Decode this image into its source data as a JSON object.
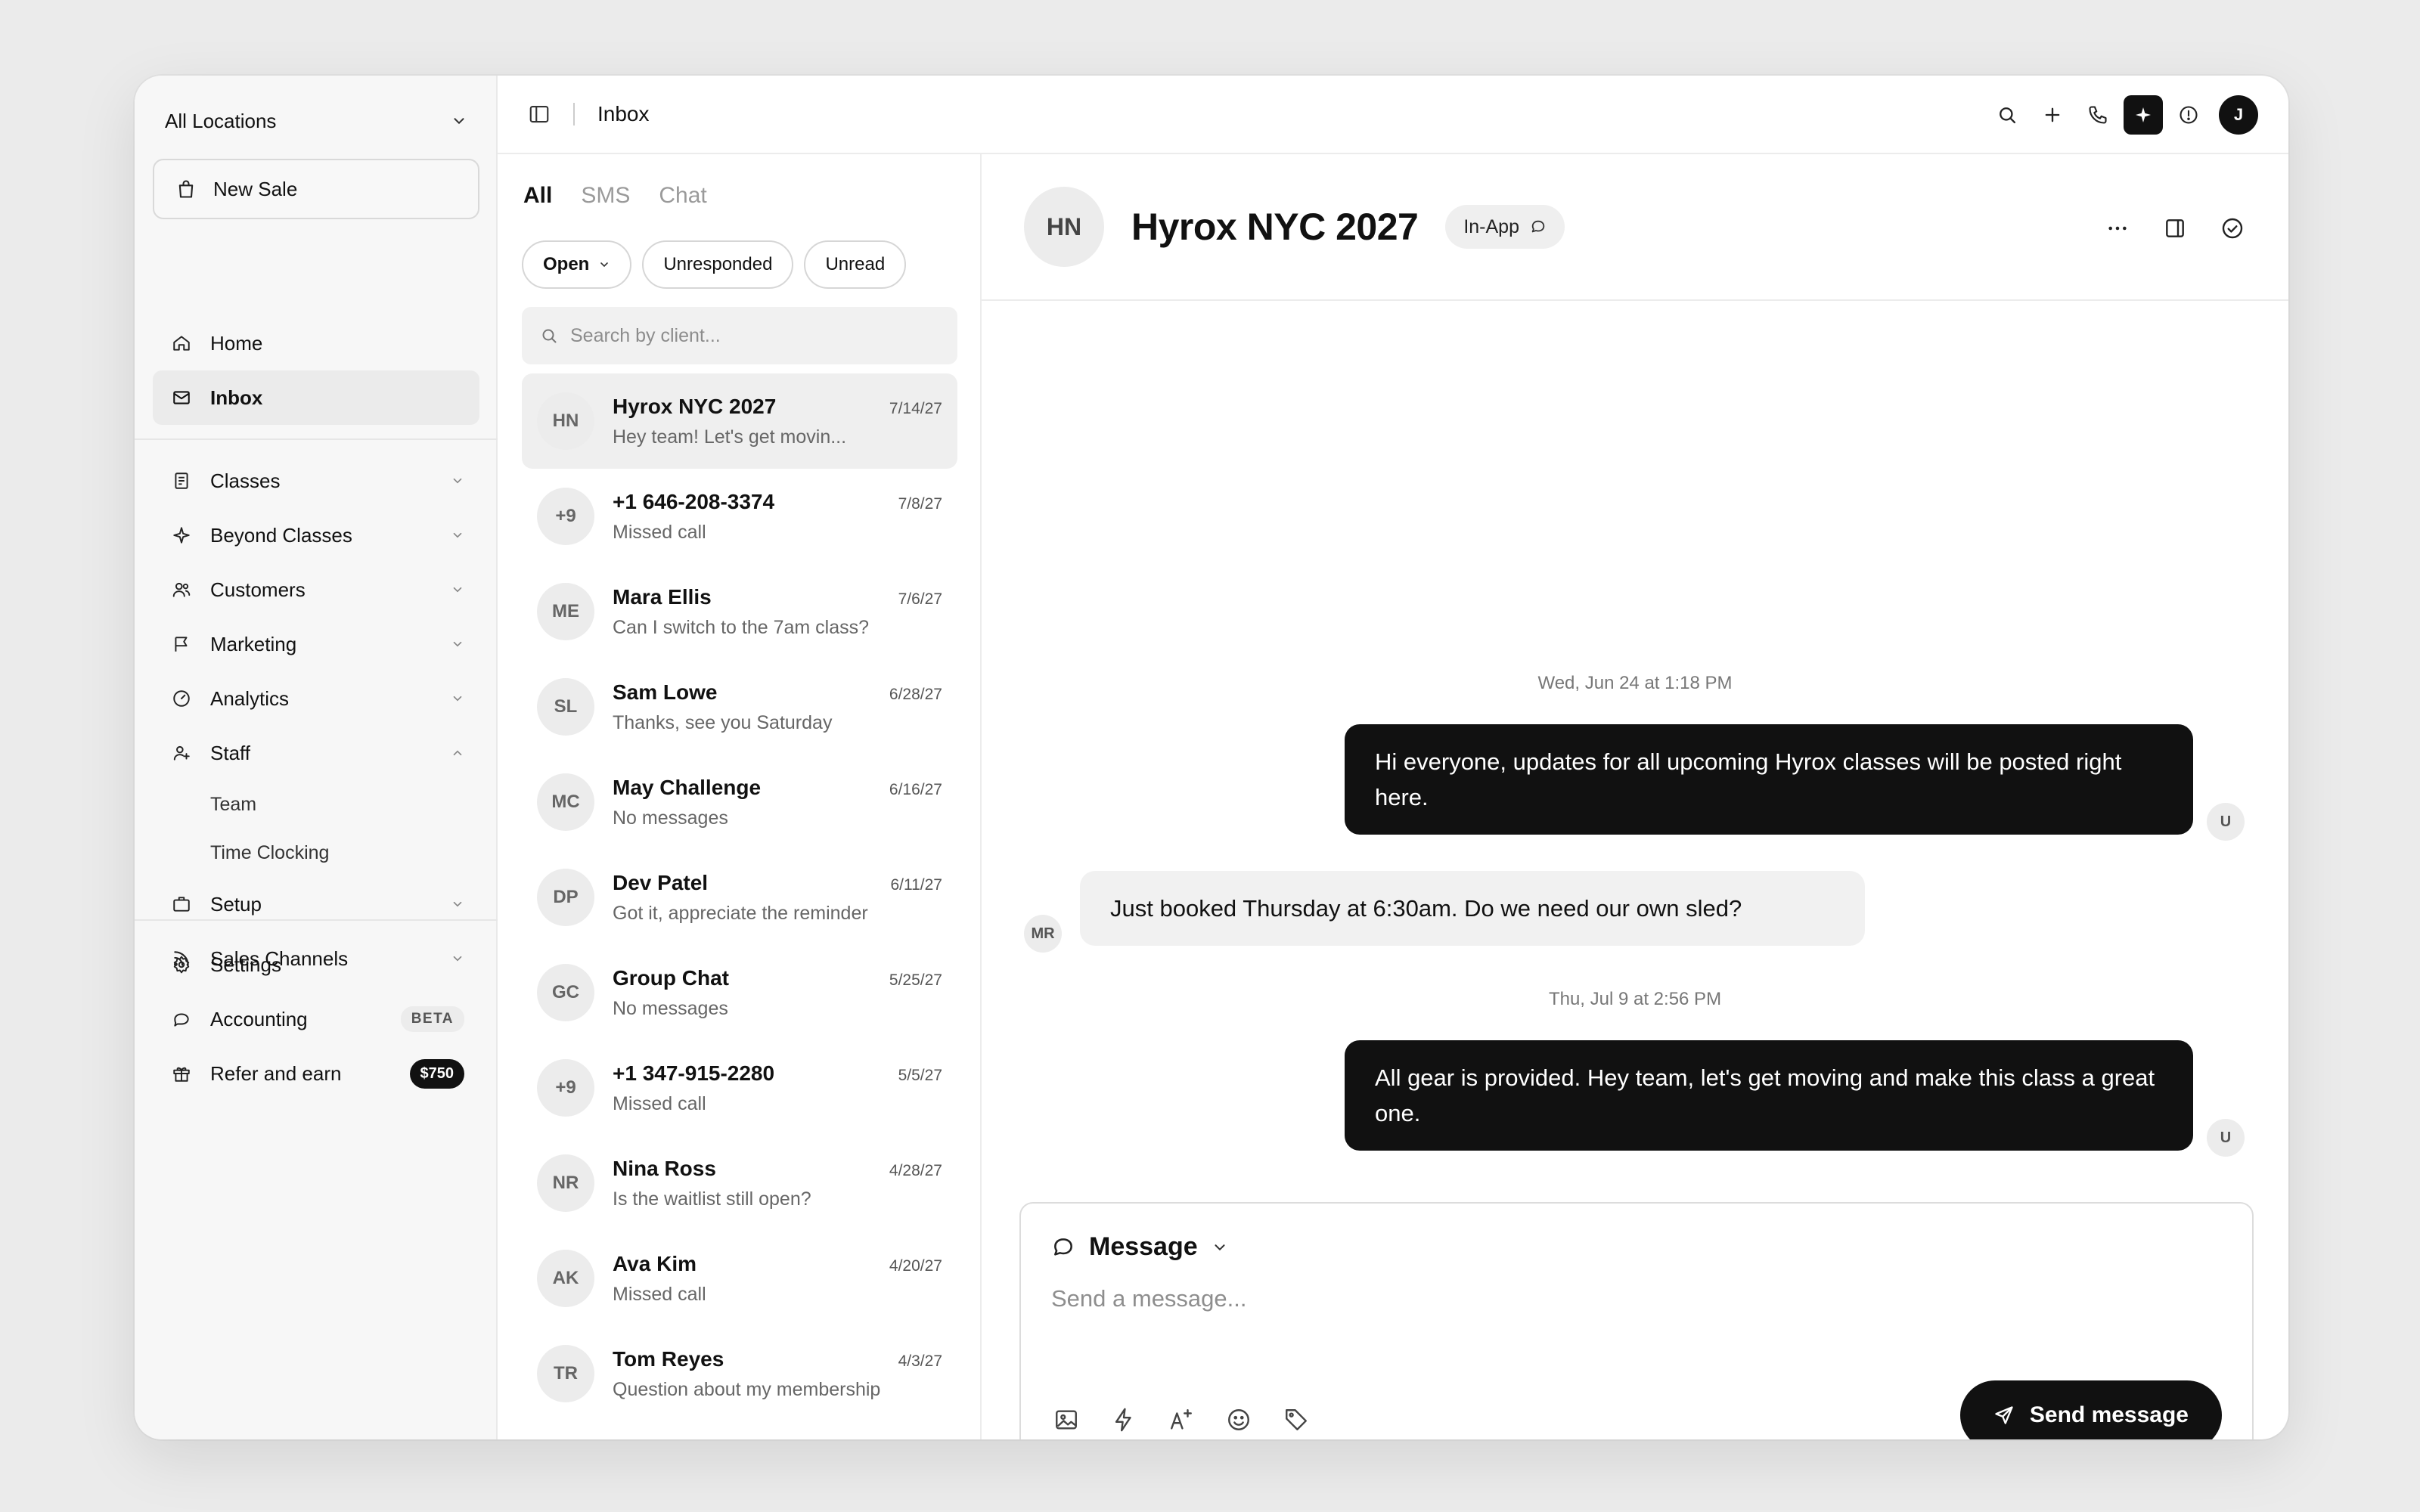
{
  "sidebar": {
    "location": "All Locations",
    "new_sale": "New Sale",
    "nav": [
      {
        "key": "home",
        "label": "Home"
      },
      {
        "key": "inbox",
        "label": "Inbox"
      },
      {
        "key": "classes",
        "label": "Classes"
      },
      {
        "key": "beyond",
        "label": "Beyond Classes"
      },
      {
        "key": "customers",
        "label": "Customers"
      },
      {
        "key": "marketing",
        "label": "Marketing"
      },
      {
        "key": "analytics",
        "label": "Analytics"
      },
      {
        "key": "staff",
        "label": "Staff"
      },
      {
        "key": "setup",
        "label": "Setup"
      },
      {
        "key": "sales",
        "label": "Sales Channels"
      }
    ],
    "staff_sub": [
      "Team",
      "Time Clocking"
    ],
    "bottom": [
      {
        "key": "settings",
        "label": "Settings"
      },
      {
        "key": "accounting",
        "label": "Accounting",
        "badge": "BETA"
      },
      {
        "key": "refer",
        "label": "Refer and earn",
        "badge": "$750"
      }
    ]
  },
  "topbar": {
    "title": "Inbox",
    "avatar": "J"
  },
  "inbox": {
    "tabs": [
      "All",
      "SMS",
      "Chat"
    ],
    "filters": {
      "open": "Open",
      "unresponded": "Unresponded",
      "unread": "Unread"
    },
    "search_placeholder": "Search by client...",
    "conversations": [
      {
        "initials": "HN",
        "name": "Hyrox NYC 2027",
        "date": "7/14/27",
        "preview": "Hey team! Let's get movin..."
      },
      {
        "initials": "+9",
        "name": "+1 646-208-3374",
        "date": "7/8/27",
        "preview": "Missed call"
      },
      {
        "initials": "ME",
        "name": "Mara Ellis",
        "date": "7/6/27",
        "preview": "Can I switch to the 7am class?"
      },
      {
        "initials": "SL",
        "name": "Sam Lowe",
        "date": "6/28/27",
        "preview": "Thanks, see you Saturday"
      },
      {
        "initials": "MC",
        "name": "May Challenge",
        "date": "6/16/27",
        "preview": "No messages"
      },
      {
        "initials": "DP",
        "name": "Dev Patel",
        "date": "6/11/27",
        "preview": "Got it, appreciate the reminder"
      },
      {
        "initials": "GC",
        "name": "Group Chat",
        "date": "5/25/27",
        "preview": "No messages"
      },
      {
        "initials": "+9",
        "name": "+1 347-915-2280",
        "date": "5/5/27",
        "preview": "Missed call"
      },
      {
        "initials": "NR",
        "name": "Nina Ross",
        "date": "4/28/27",
        "preview": "Is the waitlist still open?"
      },
      {
        "initials": "AK",
        "name": "Ava Kim",
        "date": "4/20/27",
        "preview": "Missed call"
      },
      {
        "initials": "TR",
        "name": "Tom Reyes",
        "date": "4/3/27",
        "preview": "Question about my membership"
      }
    ]
  },
  "chat": {
    "initials": "HN",
    "name": "Hyrox NYC 2027",
    "channel": "In-App",
    "stamp1": "Wed, Jun 24 at 1:18 PM",
    "msg1": "Hi everyone, updates for all upcoming Hyrox classes will be posted right here.",
    "msg1_avatar": "U",
    "msg2": "Just booked Thursday at 6:30am. Do we need our own sled?",
    "msg2_avatar": "MR",
    "stamp2": "Thu, Jul 9 at 2:56 PM",
    "msg3": "All gear is provided. Hey team, let's get moving and make this class a great one.",
    "msg3_avatar": "U",
    "composer_mode": "Message",
    "composer_placeholder": "Send a message...",
    "send_label": "Send message"
  }
}
